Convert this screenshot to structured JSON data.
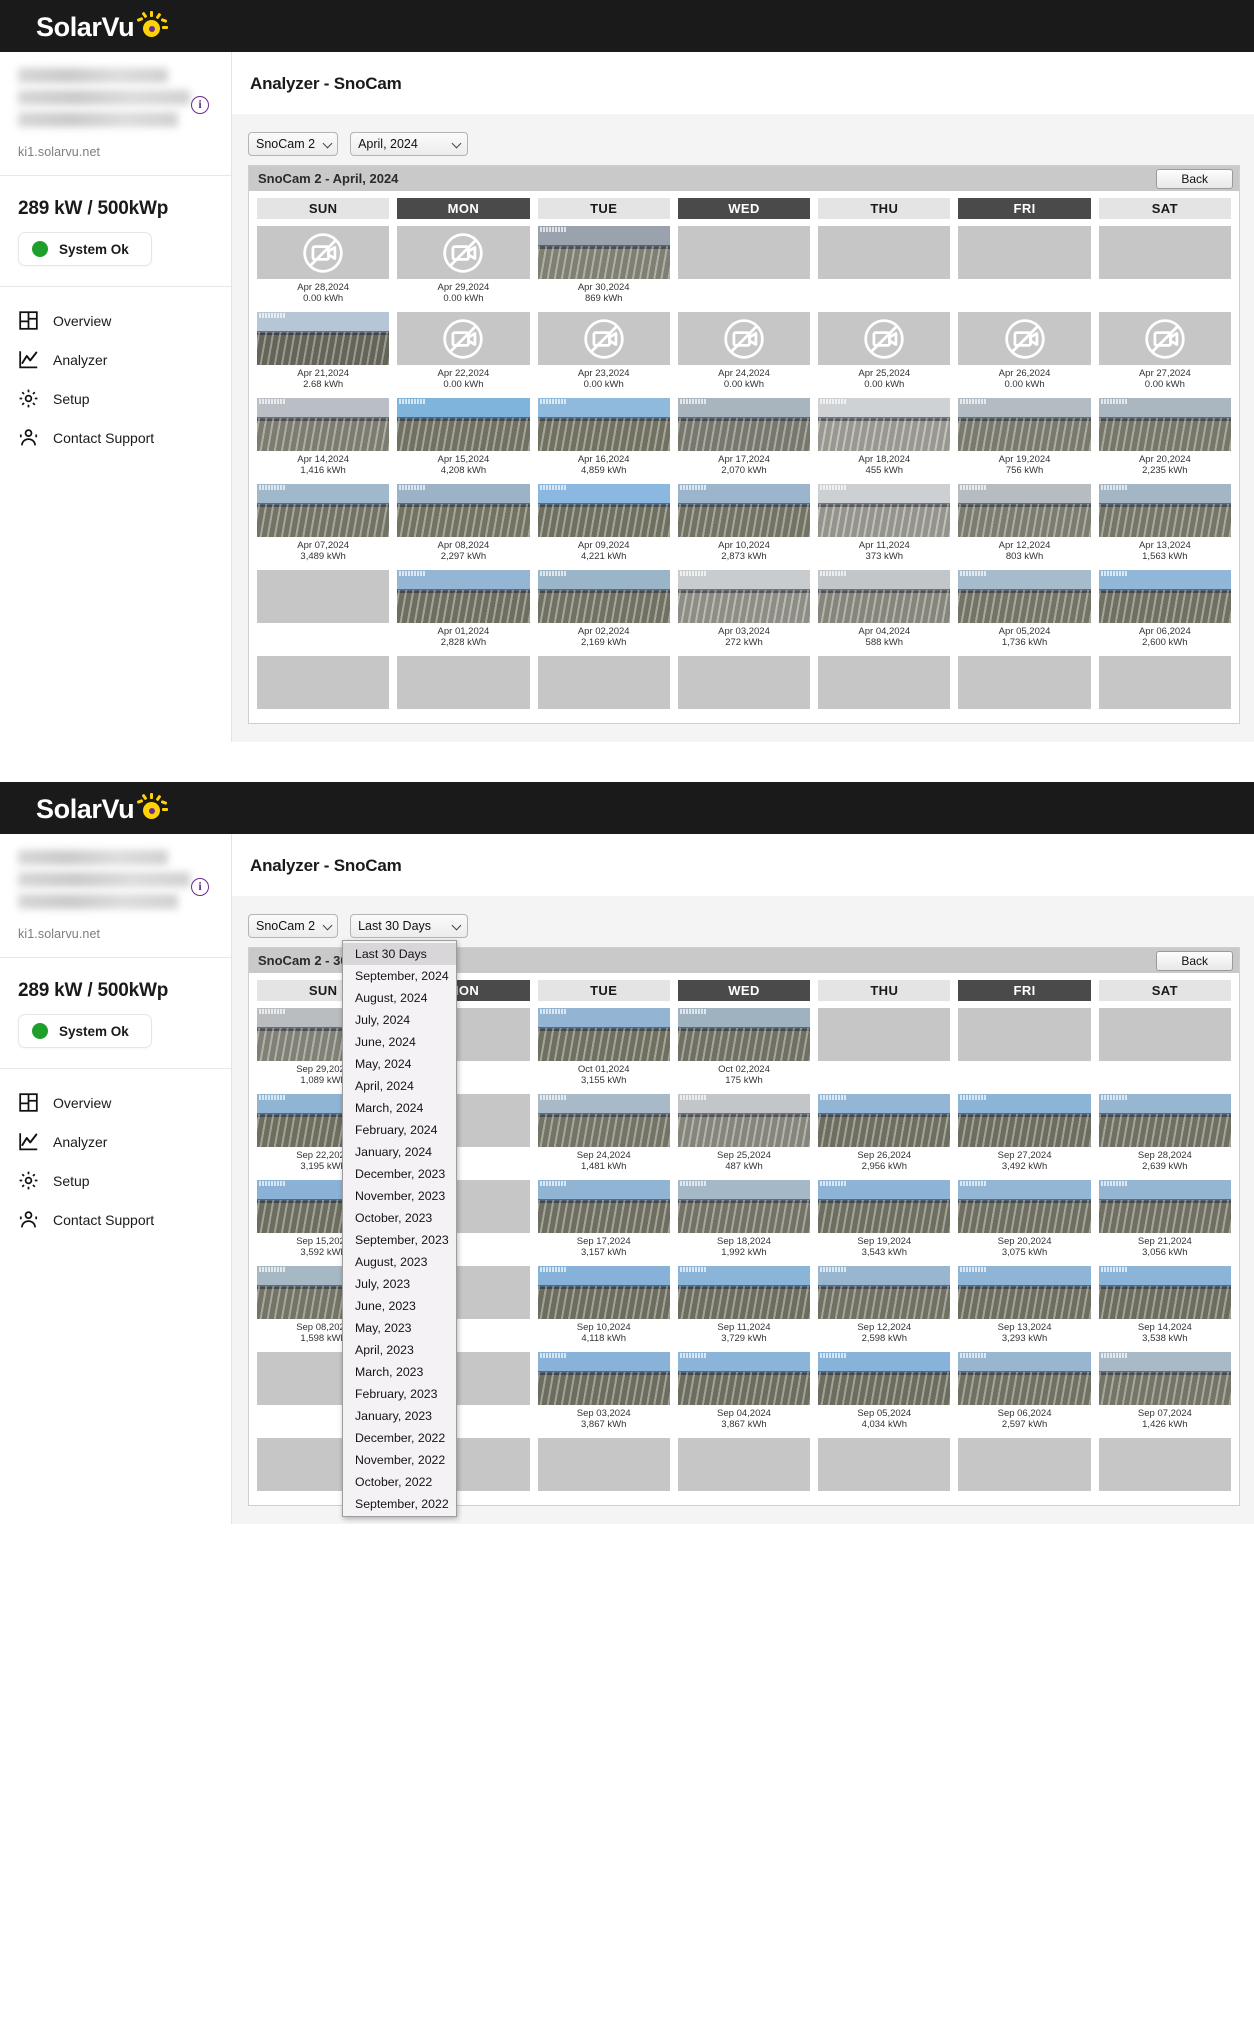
{
  "brand": {
    "name": "SolarVu",
    "logo_icon": "sun-icon"
  },
  "sidebar": {
    "site_url": "ki1.solarvu.net",
    "info_icon": "info-icon",
    "capacity": "289 kW / 500kWp",
    "status_label": "System Ok",
    "status_color": "#1f9e2c",
    "items": [
      {
        "label": "Overview",
        "icon": "dashboard-grid-icon"
      },
      {
        "label": "Analyzer",
        "icon": "line-chart-icon"
      },
      {
        "label": "Setup",
        "icon": "gear-icon"
      },
      {
        "label": "Contact Support",
        "icon": "support-agent-icon"
      }
    ]
  },
  "page": {
    "title": "Analyzer - SnoCam"
  },
  "panel1": {
    "camera_select": {
      "value": "SnoCam 2"
    },
    "period_select": {
      "value": "April, 2024"
    },
    "calendar_title": "SnoCam 2 - April, 2024",
    "back_label": "Back",
    "dow": [
      {
        "label": "SUN",
        "highlight": false
      },
      {
        "label": "MON",
        "highlight": true
      },
      {
        "label": "TUE",
        "highlight": false
      },
      {
        "label": "WED",
        "highlight": true
      },
      {
        "label": "THU",
        "highlight": false
      },
      {
        "label": "FRI",
        "highlight": true
      },
      {
        "label": "SAT",
        "highlight": false
      }
    ],
    "cells": [
      {
        "date": "Apr 28,2024",
        "kwh": "0.00 kWh",
        "state": "nocam"
      },
      {
        "date": "Apr 29,2024",
        "kwh": "0.00 kWh",
        "state": "nocam"
      },
      {
        "date": "Apr 30,2024",
        "kwh": "869 kWh",
        "state": "photo",
        "sky": "#9aa3ad",
        "ground": "#8d8d80"
      },
      {
        "date": "",
        "kwh": "",
        "state": "empty"
      },
      {
        "date": "",
        "kwh": "",
        "state": "empty"
      },
      {
        "date": "",
        "kwh": "",
        "state": "empty"
      },
      {
        "date": "",
        "kwh": "",
        "state": "empty"
      },
      {
        "date": "Apr 21,2024",
        "kwh": "2.68 kWh",
        "state": "photo",
        "sky": "#b7c6d6",
        "ground": "#6f6f63"
      },
      {
        "date": "Apr 22,2024",
        "kwh": "0.00 kWh",
        "state": "nocam"
      },
      {
        "date": "Apr 23,2024",
        "kwh": "0.00 kWh",
        "state": "nocam"
      },
      {
        "date": "Apr 24,2024",
        "kwh": "0.00 kWh",
        "state": "nocam"
      },
      {
        "date": "Apr 25,2024",
        "kwh": "0.00 kWh",
        "state": "nocam"
      },
      {
        "date": "Apr 26,2024",
        "kwh": "0.00 kWh",
        "state": "nocam"
      },
      {
        "date": "Apr 27,2024",
        "kwh": "0.00 kWh",
        "state": "nocam"
      },
      {
        "date": "Apr 14,2024",
        "kwh": "1,416 kWh",
        "state": "photo",
        "sky": "#b9bfc4",
        "ground": "#8a8a7c"
      },
      {
        "date": "Apr 15,2024",
        "kwh": "4,208 kWh",
        "state": "photo",
        "sky": "#7fb4dd",
        "ground": "#7d7d6e"
      },
      {
        "date": "Apr 16,2024",
        "kwh": "4,859 kWh",
        "state": "photo",
        "sky": "#8fbade",
        "ground": "#7e7e6d"
      },
      {
        "date": "Apr 17,2024",
        "kwh": "2,070 kWh",
        "state": "photo",
        "sky": "#a8b4be",
        "ground": "#84847a"
      },
      {
        "date": "Apr 18,2024",
        "kwh": "455 kWh",
        "state": "photo",
        "sky": "#cfd2d4",
        "ground": "#a9a9a0"
      },
      {
        "date": "Apr 19,2024",
        "kwh": "756 kWh",
        "state": "photo",
        "sky": "#b4bcc3",
        "ground": "#87877a"
      },
      {
        "date": "Apr 20,2024",
        "kwh": "2,235 kWh",
        "state": "photo",
        "sky": "#aab6c0",
        "ground": "#838375"
      },
      {
        "date": "Apr 07,2024",
        "kwh": "3,489 kWh",
        "state": "photo",
        "sky": "#9fb8cc",
        "ground": "#7f7f70"
      },
      {
        "date": "Apr 08,2024",
        "kwh": "2,297 kWh",
        "state": "photo",
        "sky": "#9cb2c6",
        "ground": "#80806f"
      },
      {
        "date": "Apr 09,2024",
        "kwh": "4,221 kWh",
        "state": "photo",
        "sky": "#8bb8e0",
        "ground": "#7c7c6c"
      },
      {
        "date": "Apr 10,2024",
        "kwh": "2,873 kWh",
        "state": "photo",
        "sky": "#9bb5cc",
        "ground": "#7f7f70"
      },
      {
        "date": "Apr 11,2024",
        "kwh": "373 kWh",
        "state": "photo",
        "sky": "#cdd0d2",
        "ground": "#a5a59c"
      },
      {
        "date": "Apr 12,2024",
        "kwh": "803 kWh",
        "state": "photo",
        "sky": "#b7bcc1",
        "ground": "#8a8a7e"
      },
      {
        "date": "Apr 13,2024",
        "kwh": "1,563 kWh",
        "state": "photo",
        "sky": "#a2b6c6",
        "ground": "#838374"
      },
      {
        "date": "",
        "kwh": "",
        "state": "empty"
      },
      {
        "date": "Apr 01,2024",
        "kwh": "2,828 kWh",
        "state": "photo",
        "sky": "#94b6d4",
        "ground": "#7b7b6b"
      },
      {
        "date": "Apr 02,2024",
        "kwh": "2,169 kWh",
        "state": "photo",
        "sky": "#9ab4c8",
        "ground": "#7e7e6e"
      },
      {
        "date": "Apr 03,2024",
        "kwh": "272 kWh",
        "state": "photo",
        "sky": "#c9ccce",
        "ground": "#9d9d94"
      },
      {
        "date": "Apr 04,2024",
        "kwh": "588 kWh",
        "state": "photo",
        "sky": "#c2c6c9",
        "ground": "#94948a"
      },
      {
        "date": "Apr 05,2024",
        "kwh": "1,736 kWh",
        "state": "photo",
        "sky": "#a6bccd",
        "ground": "#818172"
      },
      {
        "date": "Apr 06,2024",
        "kwh": "2,600 kWh",
        "state": "photo",
        "sky": "#90b6d8",
        "ground": "#7c7c6d"
      },
      {
        "date": "",
        "kwh": "",
        "state": "empty"
      },
      {
        "date": "",
        "kwh": "",
        "state": "empty"
      },
      {
        "date": "",
        "kwh": "",
        "state": "empty"
      },
      {
        "date": "",
        "kwh": "",
        "state": "empty"
      },
      {
        "date": "",
        "kwh": "",
        "state": "empty"
      },
      {
        "date": "",
        "kwh": "",
        "state": "empty"
      },
      {
        "date": "",
        "kwh": "",
        "state": "empty"
      }
    ]
  },
  "panel2": {
    "camera_select": {
      "value": "SnoCam 2"
    },
    "period_select": {
      "value": "Last 30 Days"
    },
    "calendar_title": "SnoCam 2 - 30",
    "back_label": "Back",
    "dow": [
      {
        "label": "SUN",
        "highlight": false
      },
      {
        "label": "MON",
        "highlight": true
      },
      {
        "label": "TUE",
        "highlight": false
      },
      {
        "label": "WED",
        "highlight": true
      },
      {
        "label": "THU",
        "highlight": false
      },
      {
        "label": "FRI",
        "highlight": true
      },
      {
        "label": "SAT",
        "highlight": false
      }
    ],
    "dropdown_open": true,
    "dropdown_options": [
      "Last 30 Days",
      "September, 2024",
      "August, 2024",
      "July, 2024",
      "June, 2024",
      "May, 2024",
      "April, 2024",
      "March, 2024",
      "February, 2024",
      "January, 2024",
      "December, 2023",
      "November, 2023",
      "October, 2023",
      "September, 2023",
      "August, 2023",
      "July, 2023",
      "June, 2023",
      "May, 2023",
      "April, 2023",
      "March, 2023",
      "February, 2023",
      "January, 2023",
      "December, 2022",
      "November, 2022",
      "October, 2022",
      "September, 2022"
    ],
    "cells": [
      {
        "date": "Sep 29,2024",
        "kwh": "1,089 kWh",
        "state": "photo",
        "sky": "#b9bdc0",
        "ground": "#8e8e84"
      },
      {
        "date": "",
        "kwh": "",
        "state": "empty"
      },
      {
        "date": "Oct 01,2024",
        "kwh": "3,155 kWh",
        "state": "photo",
        "sky": "#93b4d2",
        "ground": "#7c7c6c"
      },
      {
        "date": "Oct 02,2024",
        "kwh": "175 kWh",
        "state": "photo",
        "sky": "#9eb2c0",
        "ground": "#7c7c6f"
      },
      {
        "date": "",
        "kwh": "",
        "state": "empty"
      },
      {
        "date": "",
        "kwh": "",
        "state": "empty"
      },
      {
        "date": "",
        "kwh": "",
        "state": "empty"
      },
      {
        "date": "Sep 22,2024",
        "kwh": "3,195 kWh",
        "state": "photo",
        "sky": "#8fb4d4",
        "ground": "#7a7a6a"
      },
      {
        "date": "",
        "kwh": "",
        "state": "empty"
      },
      {
        "date": "Sep 24,2024",
        "kwh": "1,481 kWh",
        "state": "photo",
        "sky": "#a8bac8",
        "ground": "#808072"
      },
      {
        "date": "Sep 25,2024",
        "kwh": "487 kWh",
        "state": "photo",
        "sky": "#c2c6c8",
        "ground": "#949489"
      },
      {
        "date": "Sep 26,2024",
        "kwh": "2,956 kWh",
        "state": "photo",
        "sky": "#93b6d6",
        "ground": "#7b7b6b"
      },
      {
        "date": "Sep 27,2024",
        "kwh": "3,492 kWh",
        "state": "photo",
        "sky": "#8cb4d6",
        "ground": "#79796a"
      },
      {
        "date": "Sep 28,2024",
        "kwh": "2,639 kWh",
        "state": "photo",
        "sky": "#97b6d2",
        "ground": "#7c7c6d"
      },
      {
        "date": "Sep 15,2024",
        "kwh": "3,592 kWh",
        "state": "photo",
        "sky": "#8ab2d6",
        "ground": "#79796a"
      },
      {
        "date": "",
        "kwh": "",
        "state": "empty"
      },
      {
        "date": "Sep 17,2024",
        "kwh": "3,157 kWh",
        "state": "photo",
        "sky": "#90b4d4",
        "ground": "#7b7b6b"
      },
      {
        "date": "Sep 18,2024",
        "kwh": "1,992 kWh",
        "state": "photo",
        "sky": "#a4b8c8",
        "ground": "#7f7f71"
      },
      {
        "date": "Sep 19,2024",
        "kwh": "3,543 kWh",
        "state": "photo",
        "sky": "#8db4d6",
        "ground": "#7a7a6b"
      },
      {
        "date": "Sep 20,2024",
        "kwh": "3,075 kWh",
        "state": "photo",
        "sky": "#92b6d4",
        "ground": "#7b7b6c"
      },
      {
        "date": "Sep 21,2024",
        "kwh": "3,056 kWh",
        "state": "photo",
        "sky": "#94b6d2",
        "ground": "#7c7c6d"
      },
      {
        "date": "Sep 08,2024",
        "kwh": "1,598 kWh",
        "state": "photo",
        "sky": "#a6b8c4",
        "ground": "#808072"
      },
      {
        "date": "",
        "kwh": "",
        "state": "empty"
      },
      {
        "date": "Sep 10,2024",
        "kwh": "4,118 kWh",
        "state": "photo",
        "sky": "#86b2da",
        "ground": "#78786a"
      },
      {
        "date": "Sep 11,2024",
        "kwh": "3,729 kWh",
        "state": "photo",
        "sky": "#8ab4d8",
        "ground": "#79796a"
      },
      {
        "date": "Sep 12,2024",
        "kwh": "2,598 kWh",
        "state": "photo",
        "sky": "#98b6d0",
        "ground": "#7d7d6e"
      },
      {
        "date": "Sep 13,2024",
        "kwh": "3,293 kWh",
        "state": "photo",
        "sky": "#8eb4d6",
        "ground": "#7a7a6b"
      },
      {
        "date": "Sep 14,2024",
        "kwh": "3,538 kWh",
        "state": "photo",
        "sky": "#8cb4d8",
        "ground": "#79796a"
      },
      {
        "date": "",
        "kwh": "",
        "state": "empty"
      },
      {
        "date": "",
        "kwh": "",
        "state": "empty"
      },
      {
        "date": "Sep 03,2024",
        "kwh": "3,867 kWh",
        "state": "photo",
        "sky": "#89b2d8",
        "ground": "#78786a"
      },
      {
        "date": "Sep 04,2024",
        "kwh": "3,867 kWh",
        "state": "photo",
        "sky": "#8ab4d8",
        "ground": "#79796a"
      },
      {
        "date": "Sep 05,2024",
        "kwh": "4,034 kWh",
        "state": "photo",
        "sky": "#87b2da",
        "ground": "#78786a"
      },
      {
        "date": "Sep 06,2024",
        "kwh": "2,597 kWh",
        "state": "photo",
        "sky": "#99b6d0",
        "ground": "#7d7d6e"
      },
      {
        "date": "Sep 07,2024",
        "kwh": "1,426 kWh",
        "state": "photo",
        "sky": "#a8bac8",
        "ground": "#818173"
      },
      {
        "date": "",
        "kwh": "",
        "state": "empty"
      },
      {
        "date": "",
        "kwh": "",
        "state": "empty"
      },
      {
        "date": "",
        "kwh": "",
        "state": "empty"
      },
      {
        "date": "",
        "kwh": "",
        "state": "empty"
      },
      {
        "date": "",
        "kwh": "",
        "state": "empty"
      },
      {
        "date": "",
        "kwh": "",
        "state": "empty"
      },
      {
        "date": "",
        "kwh": "",
        "state": "empty"
      }
    ]
  }
}
